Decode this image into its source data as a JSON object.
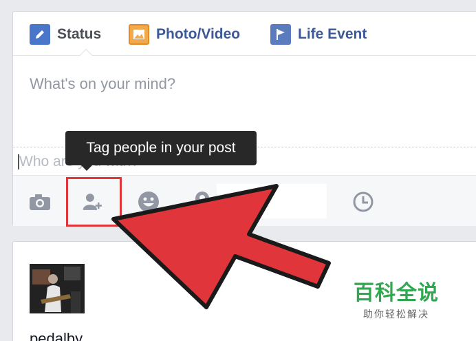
{
  "tabs": [
    {
      "label": "Status",
      "icon": "pencil-icon"
    },
    {
      "label": "Photo/Video",
      "icon": "photo-icon"
    },
    {
      "label": "Life Event",
      "icon": "flag-icon"
    }
  ],
  "composer": {
    "placeholder": "What's on your mind?",
    "with_placeholder": "Who are you with?"
  },
  "tooltip": "Tag people in your post",
  "toolbar": [
    "camera-icon",
    "tag-people-icon",
    "emoji-icon",
    "location-icon",
    "clock-icon"
  ],
  "feed": {
    "name": "pedalby"
  },
  "watermark": {
    "title": "百科全说",
    "subtitle": "助你轻松解决"
  },
  "colors": {
    "brand": "#3b5998",
    "highlight": "#e0363b",
    "watermark": "#2fa84f"
  }
}
